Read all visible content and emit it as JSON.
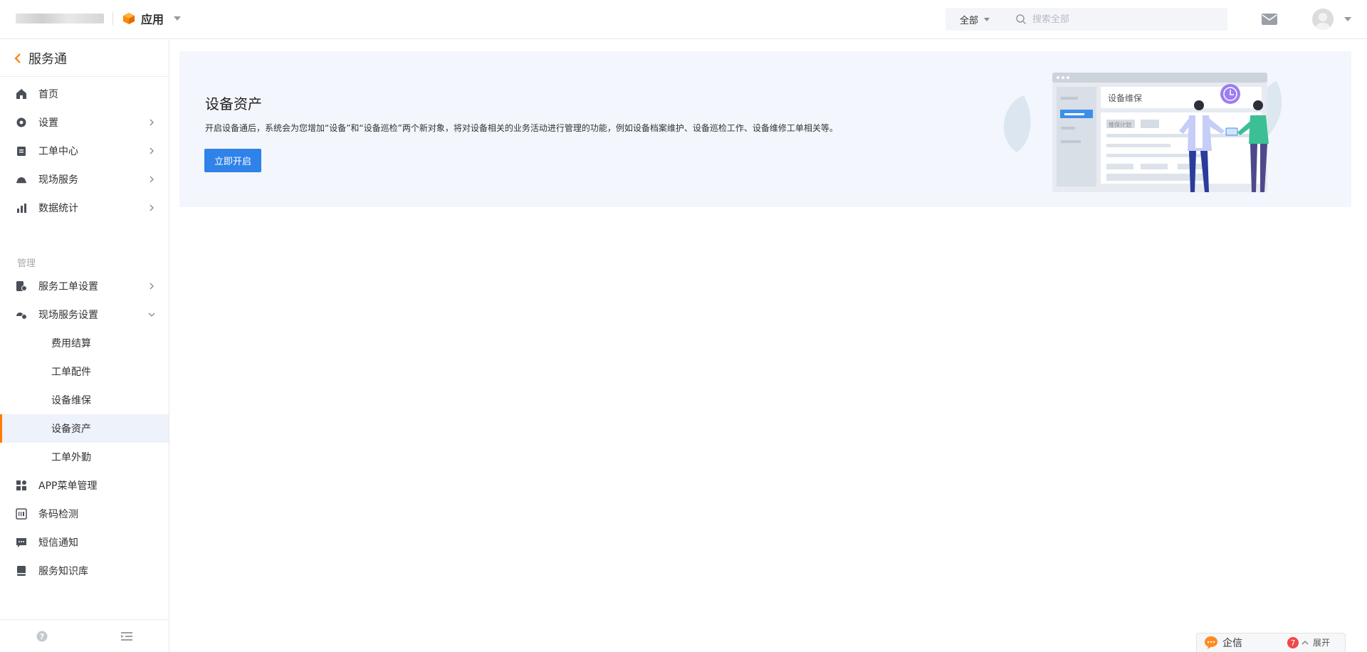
{
  "topbar": {
    "app_label": "应用",
    "search": {
      "scope_label": "全部",
      "placeholder": "搜索全部"
    }
  },
  "sidebar": {
    "back_label": "服务通",
    "items": [
      {
        "label": "首页",
        "icon": "home-icon"
      },
      {
        "label": "设置",
        "icon": "gear-icon"
      },
      {
        "label": "工单中心",
        "icon": "clipboard-icon"
      },
      {
        "label": "现场服务",
        "icon": "helmet-icon"
      },
      {
        "label": "数据统计",
        "icon": "bar-chart-icon"
      }
    ],
    "section_title": "管理",
    "manage_items": [
      {
        "label": "服务工单设置",
        "icon": "ticket-settings-icon"
      },
      {
        "label": "现场服务设置",
        "icon": "field-settings-icon"
      }
    ],
    "sub_items": [
      {
        "label": "费用结算"
      },
      {
        "label": "工单配件"
      },
      {
        "label": "设备维保"
      },
      {
        "label": "设备资产"
      },
      {
        "label": "工单外勤"
      }
    ],
    "bottom_items": [
      {
        "label": "APP菜单管理",
        "icon": "grid-icon"
      },
      {
        "label": "条码检测",
        "icon": "barcode-icon"
      },
      {
        "label": "短信通知",
        "icon": "message-icon"
      },
      {
        "label": "服务知识库",
        "icon": "book-icon"
      }
    ]
  },
  "banner": {
    "title": "设备资产",
    "description": "开启设备通后，系统会为您增加“设备”和“设备巡检”两个新对象，将对设备相关的业务活动进行管理的功能，例如设备档案维护、设备巡检工作、设备维修工单相关等。",
    "button_label": "立即开启",
    "illustration": {
      "card_title": "设备维保",
      "tag_label": "维保计划"
    }
  },
  "chat": {
    "label": "企信",
    "badge": "7",
    "expand_label": "展开"
  },
  "colors": {
    "accent": "#2f82e8",
    "active_bar": "#ff7c00",
    "banner_bg": "#f3f6fc",
    "badge": "#f04848"
  }
}
